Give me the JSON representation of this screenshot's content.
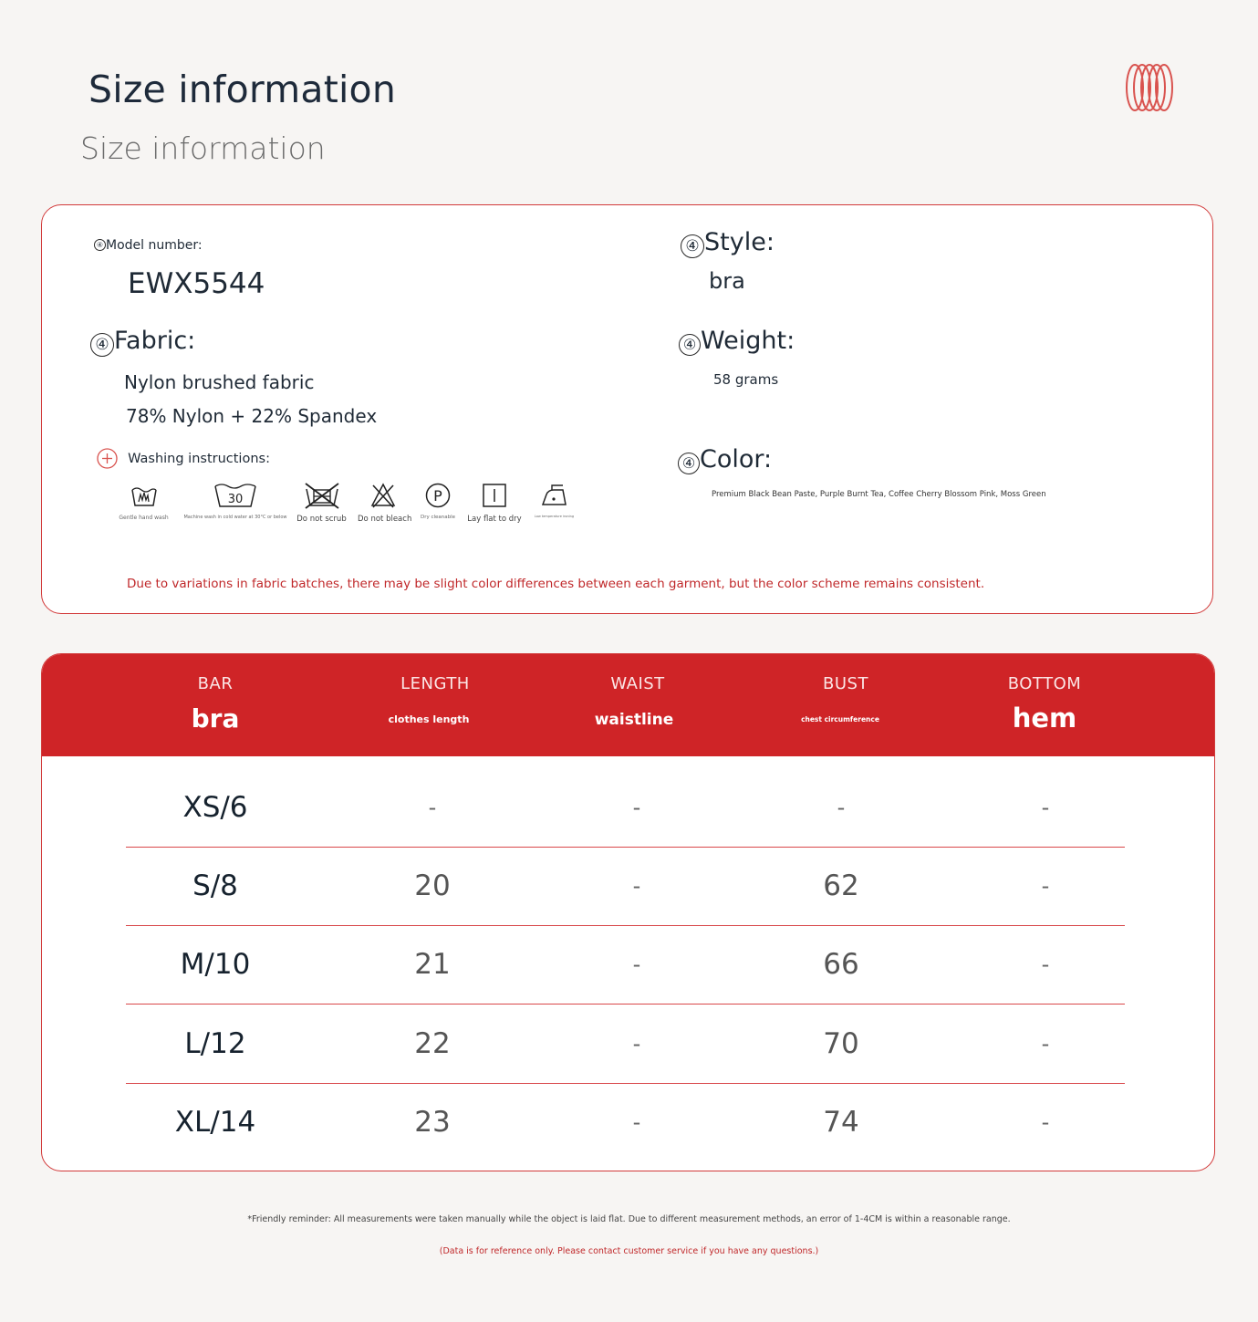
{
  "header": {
    "title": "Size information",
    "subtitle": "Size information"
  },
  "info": {
    "bullet": "④",
    "model_label": "Model number:",
    "model_value": "EWX5544",
    "style_label": "Style:",
    "style_value": "bra",
    "fabric_label": "Fabric:",
    "fabric_line1": "Nylon brushed fabric",
    "fabric_line2": "78% Nylon + 22% Spandex",
    "weight_label": "Weight:",
    "weight_value": "58 grams",
    "washing_label": "Washing instructions:",
    "color_label": "Color:",
    "color_value": "Premium Black Bean Paste, Purple Burnt Tea, Coffee Cherry Blossom Pink, Moss Green",
    "notice": "Due to variations in fabric batches, there may be slight color differences between each garment, but the color scheme remains consistent."
  },
  "care_icons": [
    {
      "icon": "hand-wash-icon",
      "caption": "Gentle hand wash"
    },
    {
      "icon": "machine-wash-30-icon",
      "temp": "30",
      "caption": "Machine wash in cold water at 30°C or below"
    },
    {
      "icon": "do-not-scrub-icon",
      "caption": "Do not scrub"
    },
    {
      "icon": "do-not-bleach-icon",
      "caption": "Do not bleach"
    },
    {
      "icon": "dry-clean-icon",
      "letter": "P",
      "caption": "Dry cleanable"
    },
    {
      "icon": "lay-flat-dry-icon",
      "caption": "Lay flat to dry"
    },
    {
      "icon": "low-iron-icon",
      "caption": "Low temperature ironing"
    }
  ],
  "table": {
    "headers": [
      {
        "en": "BAR",
        "cn": "bra"
      },
      {
        "en": "LENGTH",
        "cn": "clothes length"
      },
      {
        "en": "WAIST",
        "cn": "waistline"
      },
      {
        "en": "BUST",
        "cn": "chest circumference"
      },
      {
        "en": "BOTTOM",
        "cn": "hem"
      }
    ],
    "rows": [
      [
        "XS/6",
        "-",
        "-",
        "-",
        "-"
      ],
      [
        "S/8",
        "20",
        "-",
        "62",
        "-"
      ],
      [
        "M/10",
        "21",
        "-",
        "66",
        "-"
      ],
      [
        "L/12",
        "22",
        "-",
        "70",
        "-"
      ],
      [
        "XL/14",
        "23",
        "-",
        "74",
        "-"
      ]
    ]
  },
  "footer": {
    "reminder": "*Friendly reminder: All measurements were taken manually while the object is laid flat. Due to different measurement methods, an error of 1-4CM is within a reasonable range.",
    "reference": "(Data is for reference only. Please contact customer service if you have any questions.)"
  },
  "colors": {
    "accent": "#cf2427",
    "border": "#d23a3a",
    "background": "#f7f5f3"
  }
}
